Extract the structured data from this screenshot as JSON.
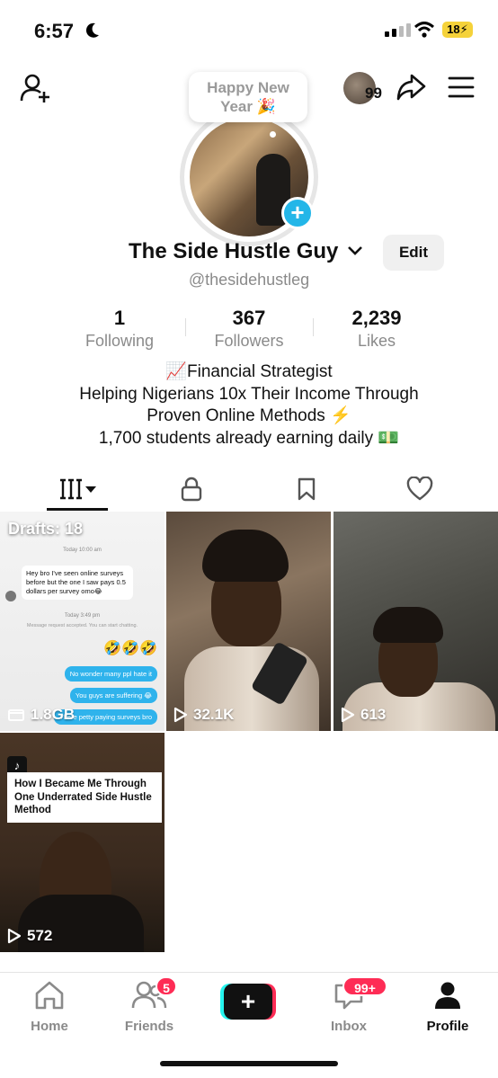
{
  "status_bar": {
    "time": "6:57",
    "battery": "18"
  },
  "header": {
    "new_year_bubble_line1": "Happy New",
    "new_year_bubble_line2": "Year 🎉",
    "mini_avatar_count": "99"
  },
  "profile": {
    "display_name": "The Side Hustle Guy",
    "username": "@thesidehustleg",
    "edit_label": "Edit"
  },
  "stats": [
    {
      "value": "1",
      "label": "Following"
    },
    {
      "value": "367",
      "label": "Followers"
    },
    {
      "value": "2,239",
      "label": "Likes"
    }
  ],
  "bio": [
    "📈Financial Strategist",
    "Helping Nigerians 10x Their Income Through",
    "Proven Online Methods ⚡️",
    "1,700 students already earning daily 💵"
  ],
  "grid": {
    "drafts": {
      "label": "Drafts: 18",
      "size": "1.8GB",
      "chat_time_1": "Today 10:00 am",
      "chat_in": "Hey bro I've seen online surveys before but the one I saw pays 0.5 dollars per survey omo😂",
      "chat_time_2": "Today 3:49 pm",
      "chat_note": "Message request accepted. You can start chatting.",
      "chat_emojis": "🤣🤣🤣",
      "chat_out_1": "No wonder many ppl hate it",
      "chat_out_2": "You guys are suffering 😂",
      "chat_out_3": "There petty paying surveys bro"
    },
    "videos": [
      {
        "views": "32.1K"
      },
      {
        "views": "613"
      },
      {
        "views": "572",
        "caption": "How I Became Me Through One Underrated Side Hustle Method"
      }
    ]
  },
  "bottom_nav": {
    "home": "Home",
    "friends": "Friends",
    "friends_badge": "5",
    "inbox": "Inbox",
    "inbox_badge": "99+",
    "profile": "Profile"
  }
}
